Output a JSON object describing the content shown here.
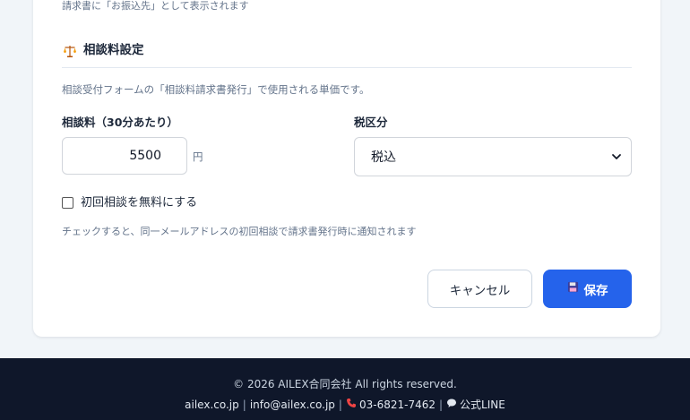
{
  "top_note": "請求書に「お振込先」として表示されます",
  "section": {
    "title": "相談料設定",
    "icon": "scales-icon",
    "description": "相談受付フォームの「相談料請求書発行」で使用される単価です。"
  },
  "fee": {
    "label": "相談料（30分あたり）",
    "value": "5500",
    "unit": "円"
  },
  "tax": {
    "label": "税区分",
    "selected": "税込"
  },
  "free_first": {
    "label": "初回相談を無料にする",
    "checked": false,
    "hint": "チェックすると、同一メールアドレスの初回相談で請求書発行時に通知されます"
  },
  "buttons": {
    "cancel": "キャンセル",
    "save": "保存",
    "save_icon": "floppy-disk-icon"
  },
  "footer": {
    "copyright": "© 2026 AILEX合同会社 All rights reserved.",
    "site": "ailex.co.jp",
    "email": "info@ailex.co.jp",
    "phone": "03-6821-7462",
    "line": "公式LINE",
    "separator": "|"
  },
  "colors": {
    "primary": "#2563eb",
    "footer_bg": "#0f172a",
    "page_bg": "#f1f5f9"
  }
}
